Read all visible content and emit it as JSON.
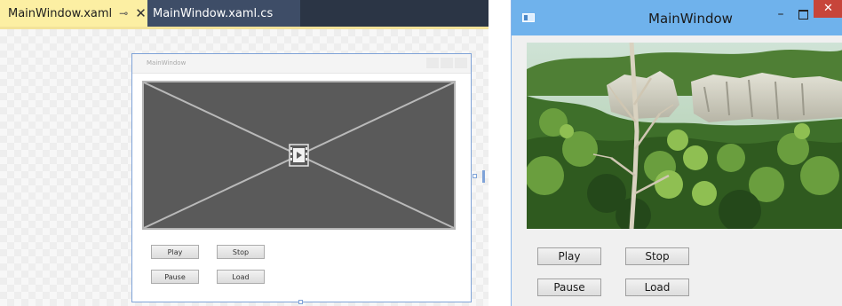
{
  "designer": {
    "tabs": [
      {
        "label": "MainWindow.xaml",
        "active": true
      },
      {
        "label": "MainWindow.xaml.cs",
        "active": false
      }
    ],
    "pin_icon": "pin-icon",
    "close_icon": "close-icon",
    "design_window": {
      "title": "MainWindow",
      "buttons": {
        "play": "Play",
        "stop": "Stop",
        "pause": "Pause",
        "load": "Load"
      }
    },
    "colors": {
      "tab_active": "#fcefa3",
      "tab_bar": "#2b3545",
      "placeholder": "#5a5a5a",
      "selection": "#7fa3d8"
    }
  },
  "app": {
    "title": "MainWindow",
    "controls": {
      "minimize": "–",
      "close": "✕"
    },
    "buttons": {
      "play": "Play",
      "stop": "Stop",
      "pause": "Pause",
      "load": "Load"
    },
    "colors": {
      "titlebar": "#6fb2ec",
      "close": "#c7453a"
    }
  }
}
